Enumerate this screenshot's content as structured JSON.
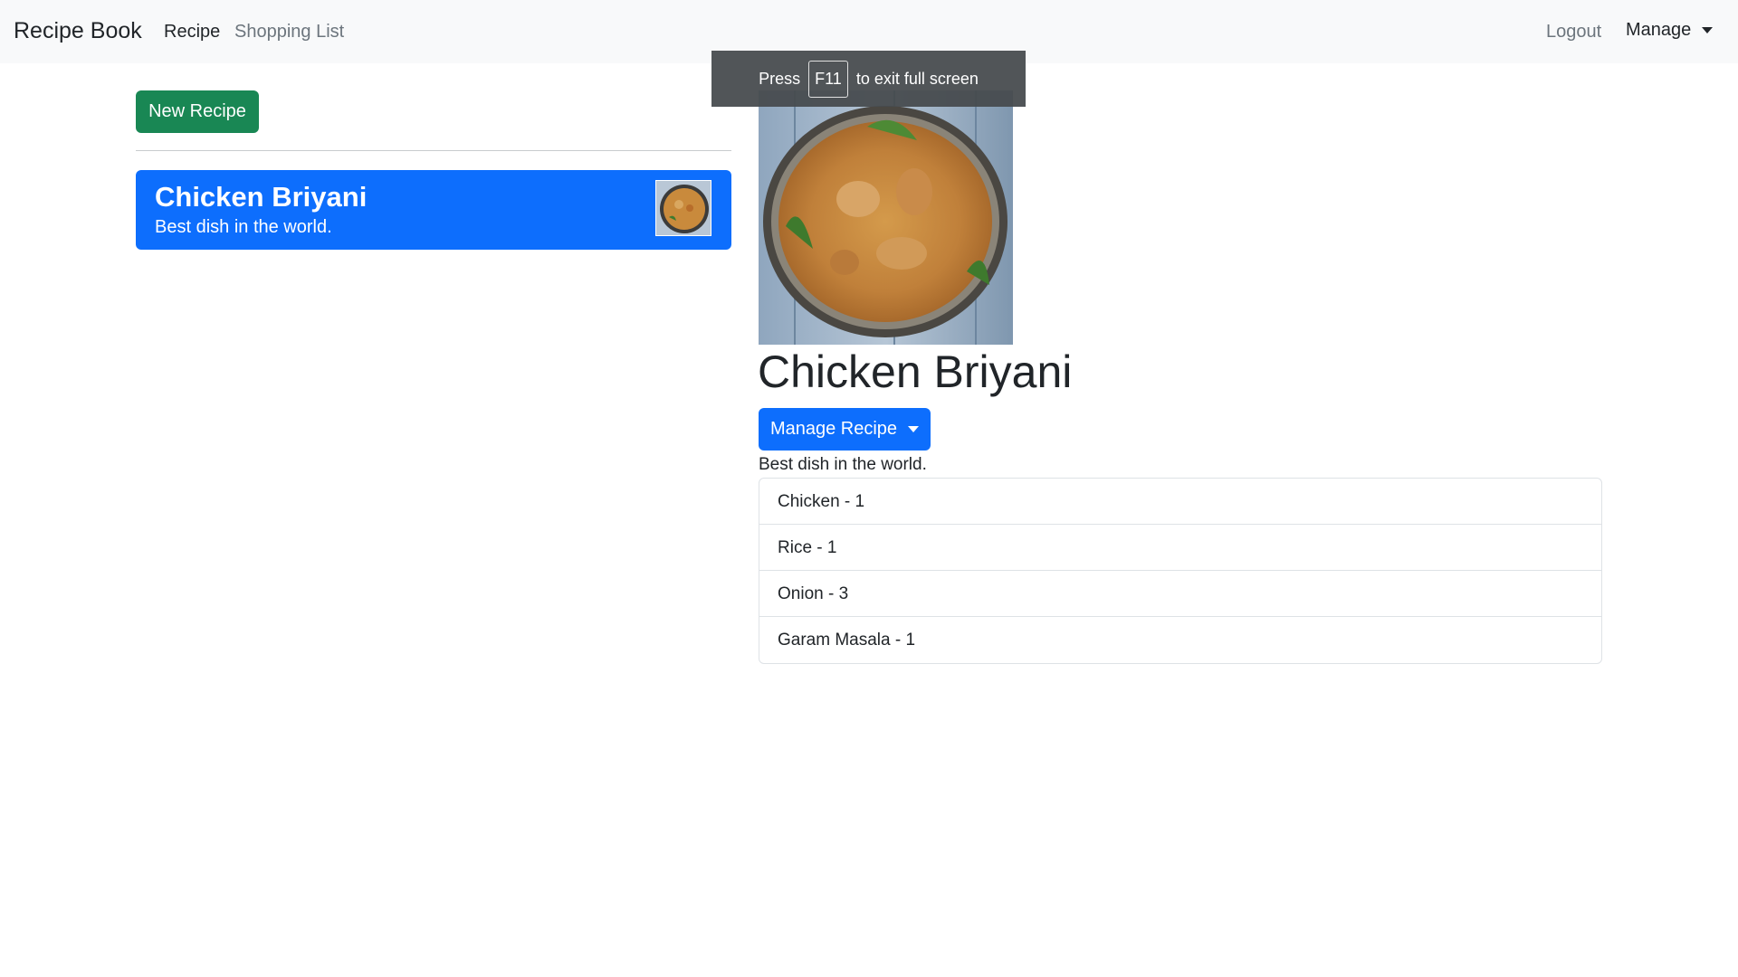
{
  "navbar": {
    "brand": "Recipe Book",
    "links": [
      "Recipe",
      "Shopping List"
    ],
    "logout": "Logout",
    "manage": "Manage"
  },
  "fullscreen_toast": {
    "press": "Press",
    "key": "F11",
    "message": "to exit full screen"
  },
  "left": {
    "new_recipe_label": "New Recipe",
    "recipes": [
      {
        "name": "Chicken Briyani",
        "description": "Best dish in the world."
      }
    ]
  },
  "detail": {
    "name": "Chicken Briyani",
    "manage_label": "Manage Recipe",
    "description": "Best dish in the world.",
    "ingredients": [
      "Chicken - 1",
      "Rice - 1",
      "Onion - 3",
      "Garam Masala - 1"
    ]
  },
  "colors": {
    "navbar_bg": "#f8f9fa",
    "success": "#198754",
    "primary": "#0d6efd"
  },
  "icons": {
    "manage_caret": "caret-down-icon",
    "recipe_image": "biryani-image"
  }
}
